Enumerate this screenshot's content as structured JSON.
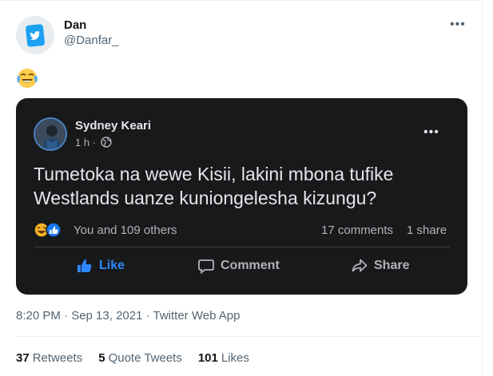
{
  "tweet": {
    "author_name": "Dan",
    "author_handle": "@Danfar_",
    "text_emoji": "face-with-tears-of-joy",
    "timestamp": "8:20 PM · Sep 13, 2021 · Twitter Web App",
    "stats": {
      "retweets_count": "37",
      "retweets_label": "Retweets",
      "quotes_count": "5",
      "quotes_label": "Quote Tweets",
      "likes_count": "101",
      "likes_label": "Likes"
    }
  },
  "fb_post": {
    "name": "Sydney Keari",
    "time": "1 h ·",
    "text": "Tumetoka na wewe Kisii, lakini mbona tufike Westlands uanze kuniongelesha kizungu?",
    "reactions_text": "You and 109 others",
    "comments": "17 comments",
    "shares": "1 share",
    "actions": {
      "like": "Like",
      "comment": "Comment",
      "share": "Share"
    }
  },
  "colors": {
    "twitter_blue": "#1da1f2",
    "fb_like_blue": "#2d88ff",
    "fb_bg": "#18191a"
  }
}
